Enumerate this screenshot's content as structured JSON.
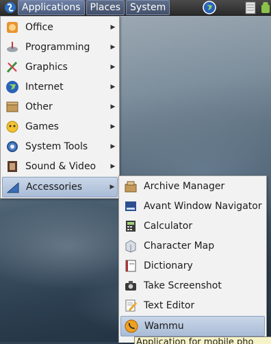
{
  "panel": {
    "menus": [
      "Applications",
      "Places",
      "System"
    ]
  },
  "applications_menu": {
    "items": [
      {
        "label": "Office",
        "icon": "office-icon"
      },
      {
        "label": "Programming",
        "icon": "programming-icon"
      },
      {
        "label": "Graphics",
        "icon": "graphics-icon"
      },
      {
        "label": "Internet",
        "icon": "internet-icon"
      },
      {
        "label": "Other",
        "icon": "other-icon"
      },
      {
        "label": "Games",
        "icon": "games-icon"
      },
      {
        "label": "System Tools",
        "icon": "system-tools-icon"
      },
      {
        "label": "Sound & Video",
        "icon": "sound-video-icon"
      },
      {
        "label": "Accessories",
        "icon": "accessories-icon"
      }
    ],
    "active": "Accessories"
  },
  "accessories_menu": {
    "items": [
      {
        "label": "Archive Manager",
        "icon": "archive-manager-icon"
      },
      {
        "label": "Avant Window Navigator",
        "icon": "avant-window-navigator-icon"
      },
      {
        "label": "Calculator",
        "icon": "calculator-icon"
      },
      {
        "label": "Character Map",
        "icon": "character-map-icon"
      },
      {
        "label": "Dictionary",
        "icon": "dictionary-icon"
      },
      {
        "label": "Take Screenshot",
        "icon": "camera-icon"
      },
      {
        "label": "Text Editor",
        "icon": "text-editor-icon"
      },
      {
        "label": "Wammu",
        "icon": "phone-icon"
      }
    ],
    "hovered": "Wammu"
  },
  "tooltip": {
    "text": "Application for mobile pho"
  },
  "colors": {
    "menu_bg": "#f2f2f2",
    "highlight": "#b9cbe2",
    "panel_bg": "#333333"
  }
}
